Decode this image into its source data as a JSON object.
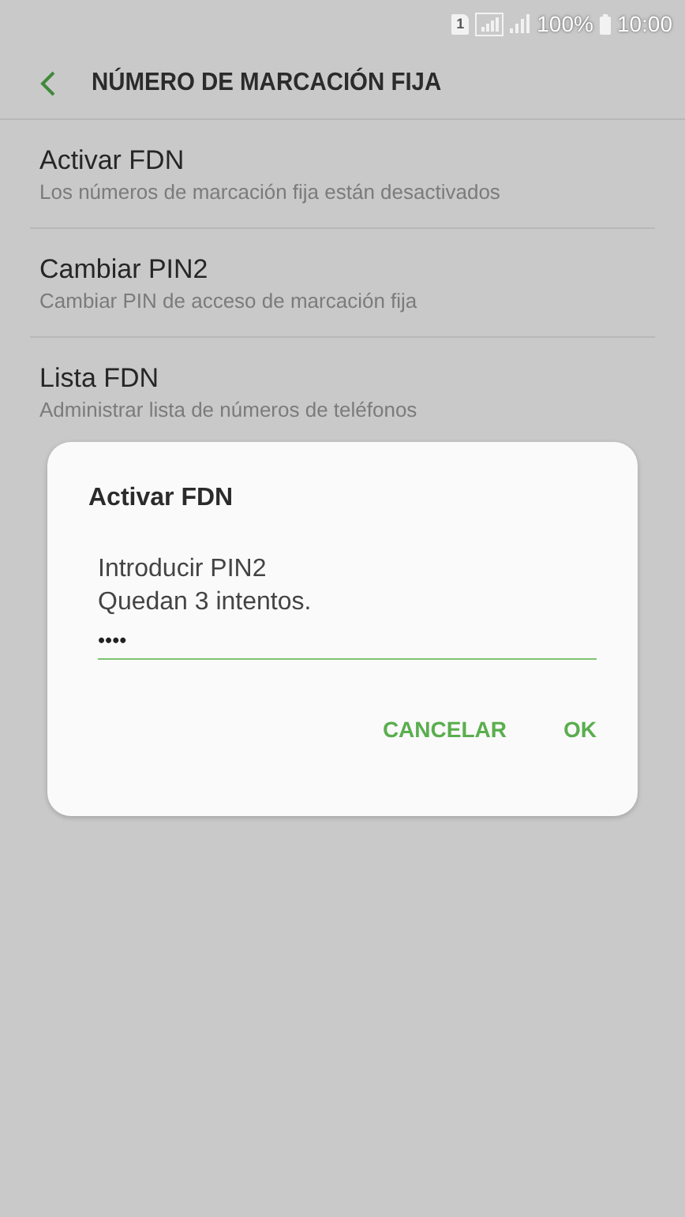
{
  "status_bar": {
    "sim_slot": "1",
    "battery_percent": "100%",
    "time": "10:00"
  },
  "header": {
    "title": "NÚMERO DE MARCACIÓN FIJA"
  },
  "settings": [
    {
      "title": "Activar FDN",
      "subtitle": "Los números de marcación fija están desactivados"
    },
    {
      "title": "Cambiar PIN2",
      "subtitle": "Cambiar PIN de acceso de marcación fija"
    },
    {
      "title": "Lista FDN",
      "subtitle": "Administrar lista de números de teléfonos"
    }
  ],
  "dialog": {
    "title": "Activar FDN",
    "message_lines": [
      "Introducir PIN2",
      "Quedan 3 intentos."
    ],
    "pin_value": "••••",
    "buttons": [
      "CANCELAR",
      "OK"
    ]
  }
}
